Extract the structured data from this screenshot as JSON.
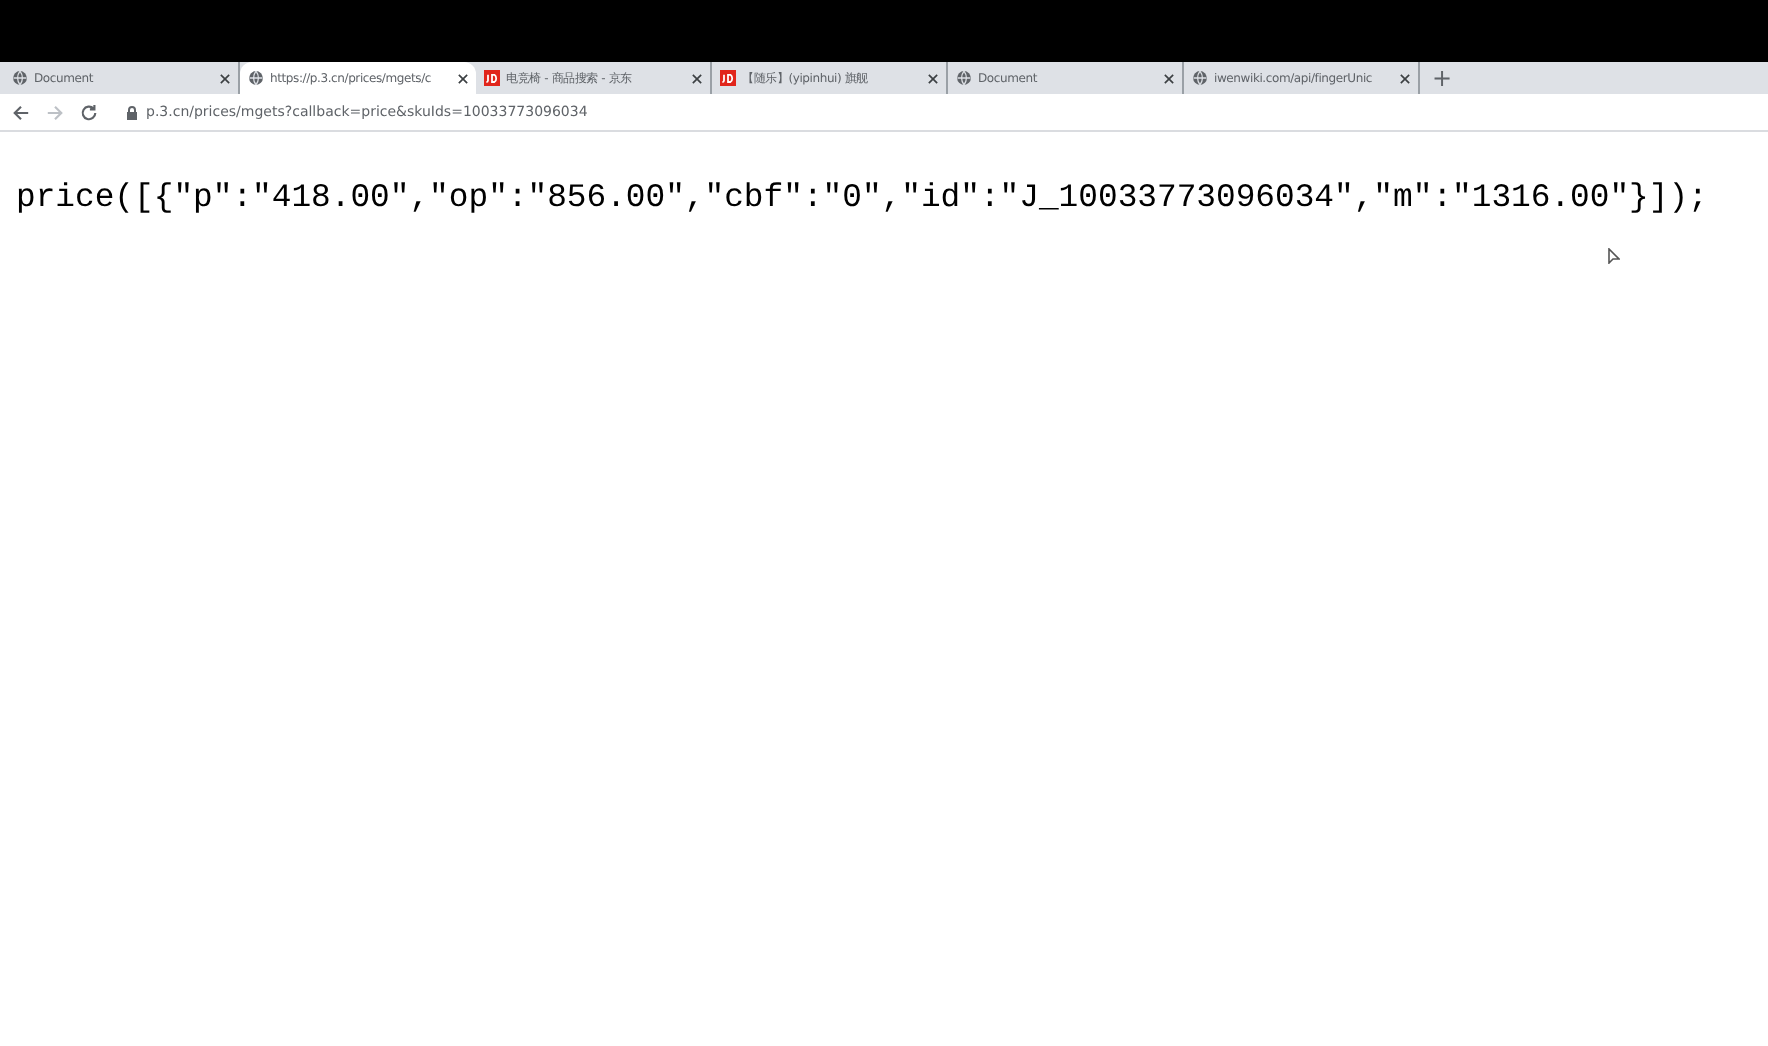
{
  "tabs": [
    {
      "title": "Document",
      "kind": "page",
      "selected": false
    },
    {
      "title": "https://p.3.cn/prices/mgets/c",
      "kind": "page",
      "selected": true
    },
    {
      "title": "电竞椅 - 商品搜索 - 京东",
      "kind": "store",
      "selected": false
    },
    {
      "title": "【随乐】(yipinhui) 旗舰",
      "kind": "store",
      "selected": false
    },
    {
      "title": "Document",
      "kind": "page",
      "selected": false
    },
    {
      "title": "iwenwiki.com/api/fingerUnic",
      "kind": "page",
      "selected": false
    }
  ],
  "new_tab": "+",
  "address": "p.3.cn/prices/mgets?callback=price&skuIds=10033773096034",
  "body_text": "price([{\"p\":\"418.00\",\"op\":\"856.00\",\"cbf\":\"0\",\"id\":\"J_10033773096034\",\"m\":\"1316.00\"}]);"
}
